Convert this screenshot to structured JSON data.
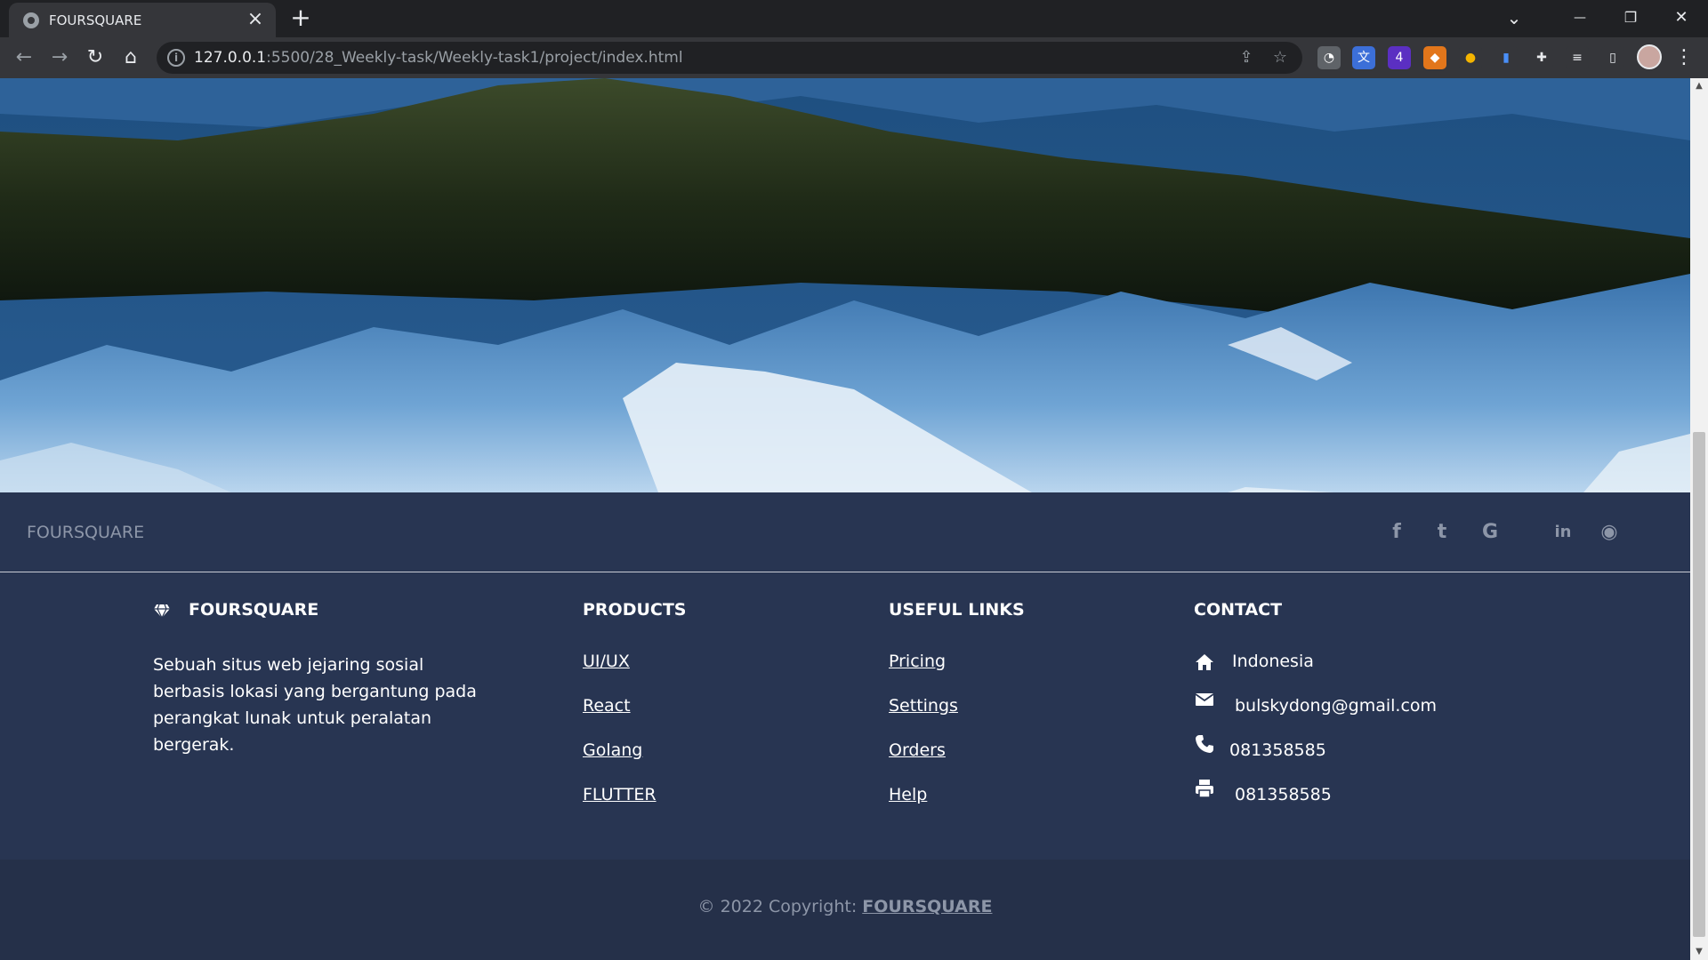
{
  "browser": {
    "tab_title": "FOURSQUARE",
    "new_tab": "+",
    "tab_close": "×",
    "url_host": "127.0.0.1",
    "url_path": ":5500/28_Weekly-task/Weekly-task1/project/index.html",
    "window_controls": {
      "tabs_menu": "⌄",
      "minimize": "—",
      "restore": "❐",
      "close": "✕"
    },
    "nav": {
      "back": "←",
      "forward": "→",
      "reload": "↻",
      "home": "⌂"
    },
    "extensions": [
      "extension-1",
      "translate-icon",
      "extension-badge-4",
      "metamask-icon",
      "extension-5",
      "extension-6",
      "puzzle-icon"
    ],
    "ext_badge": "4"
  },
  "footer_bar": {
    "brand": "FOURSQUARE",
    "social": [
      {
        "name": "facebook-icon",
        "glyph": "f"
      },
      {
        "name": "twitter-icon",
        "glyph": "t"
      },
      {
        "name": "google-icon",
        "glyph": "G"
      },
      {
        "name": "linkedin-icon",
        "glyph": "in"
      },
      {
        "name": "github-icon",
        "glyph": "◉"
      }
    ]
  },
  "footer": {
    "brand": {
      "title": "FOURSQUARE",
      "icon": "gem-icon",
      "description": "Sebuah situs web jejaring sosial berbasis lokasi yang bergantung pada perangkat lunak untuk peralatan bergerak."
    },
    "products": {
      "title": "PRODUCTS",
      "links": [
        "UI/UX",
        "React",
        "Golang",
        "FLUTTER"
      ]
    },
    "useful_links": {
      "title": "USEFUL LINKS",
      "links": [
        "Pricing",
        "Settings",
        "Orders",
        "Help"
      ]
    },
    "contact": {
      "title": "CONTACT",
      "items": [
        {
          "icon": "home-icon",
          "text": "Indonesia"
        },
        {
          "icon": "envelope-icon",
          "text": "bulskydong@gmail.com"
        },
        {
          "icon": "phone-icon",
          "text": "081358585"
        },
        {
          "icon": "printer-icon",
          "text": "081358585"
        }
      ]
    }
  },
  "copyright": {
    "prefix": "© 2022 Copyright: ",
    "link": "FOURSQUARE"
  }
}
